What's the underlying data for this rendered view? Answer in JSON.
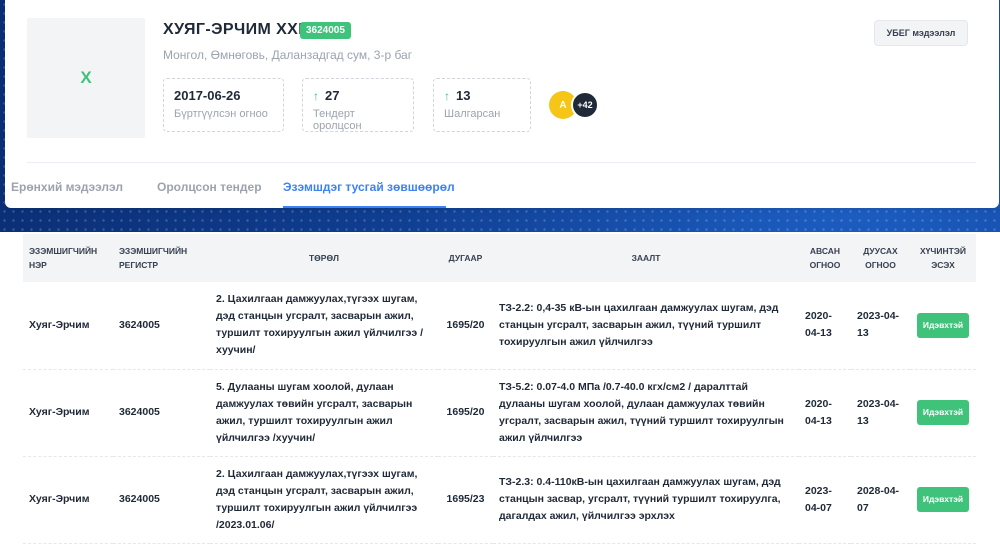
{
  "company": {
    "logo_letter": "Х",
    "name": "ХУЯГ-ЭРЧИМ ХХК",
    "reg_number": "3624005",
    "address": "Монгол, Өмнөговь, Даланзадгад сум, 3-р баг",
    "ubeg_button": "УБЕГ мэдээлэл"
  },
  "stats": [
    {
      "value": "2017-06-26",
      "label": "Бүртгүүлсэн огноо",
      "icon": ""
    },
    {
      "value": "27",
      "label": "Тендерт оролцсон",
      "icon": "arrow-up-icon"
    },
    {
      "value": "13",
      "label": "Шалгарсан",
      "icon": "arrow-up-icon"
    }
  ],
  "avatars": {
    "first_initial": "A",
    "more_count": "+42"
  },
  "tabs": [
    {
      "label": "Ерөнхий мэдээлэл",
      "active": false
    },
    {
      "label": "Оролцсон тендер",
      "active": false
    },
    {
      "label": "Эзэмшдэг тусгай зөвшөөрөл",
      "active": true
    }
  ],
  "table": {
    "headers": [
      "Эзэмшигчийн нэр",
      "Эзэмшигчийн регистр",
      "Төрөл",
      "Дугаар",
      "Заалт",
      "Авсан огноо",
      "Дуусах огноо",
      "Хүчинтэй эсэх"
    ],
    "rows": [
      {
        "owner": "Хуяг-Эрчим",
        "register": "3624005",
        "type": "2. Цахилгаан дамжуулах,түгээх шугам, дэд станцын угсралт, засварын ажил, туршилт тохируулгын ажил үйлчилгээ /хуучин/",
        "number": "1695/20",
        "clause": "ТЗ-2.2: 0,4-35 кВ-ын цахилгаан дамжуулах шугам, дэд станцын угсралт, засварын ажил, түүний туршилт тохируулгын ажил үйлчилгээ",
        "issued": "2020-04-13",
        "expires": "2023-04-13",
        "status": "Идэвхтэй"
      },
      {
        "owner": "Хуяг-Эрчим",
        "register": "3624005",
        "type": "5. Дулааны шугам хоолой, дулаан дамжуулах төвийн угсралт, засварын ажил, туршилт тохируулгын ажил үйлчилгээ /хуучин/",
        "number": "1695/20",
        "clause": "ТЗ-5.2: 0.07-4.0 МПа /0.7-40.0 кгх/см2 / даралттай дулааны шугам хоолой, дулаан дамжуулах төвийн угсралт, засварын ажил, түүний туршилт тохируулгын ажил үйлчилгээ",
        "issued": "2020-04-13",
        "expires": "2023-04-13",
        "status": "Идэвхтэй"
      },
      {
        "owner": "Хуяг-Эрчим",
        "register": "3624005",
        "type": "2. Цахилгаан дамжуулах,түгээх шугам, дэд станцын угсралт, засварын ажил, туршилт тохируулгын ажил үйлчилгээ /2023.01.06/",
        "number": "1695/23",
        "clause": "ТЗ-2.3: 0.4-110кВ-ын цахилгаан дамжуулах шугам, дэд станцын засвар, угсралт, түүний туршилт тохируулга, дагалдах ажил, үйлчилгээ эрхлэх",
        "issued": "2023-04-07",
        "expires": "2028-04-07",
        "status": "Идэвхтэй"
      }
    ]
  }
}
